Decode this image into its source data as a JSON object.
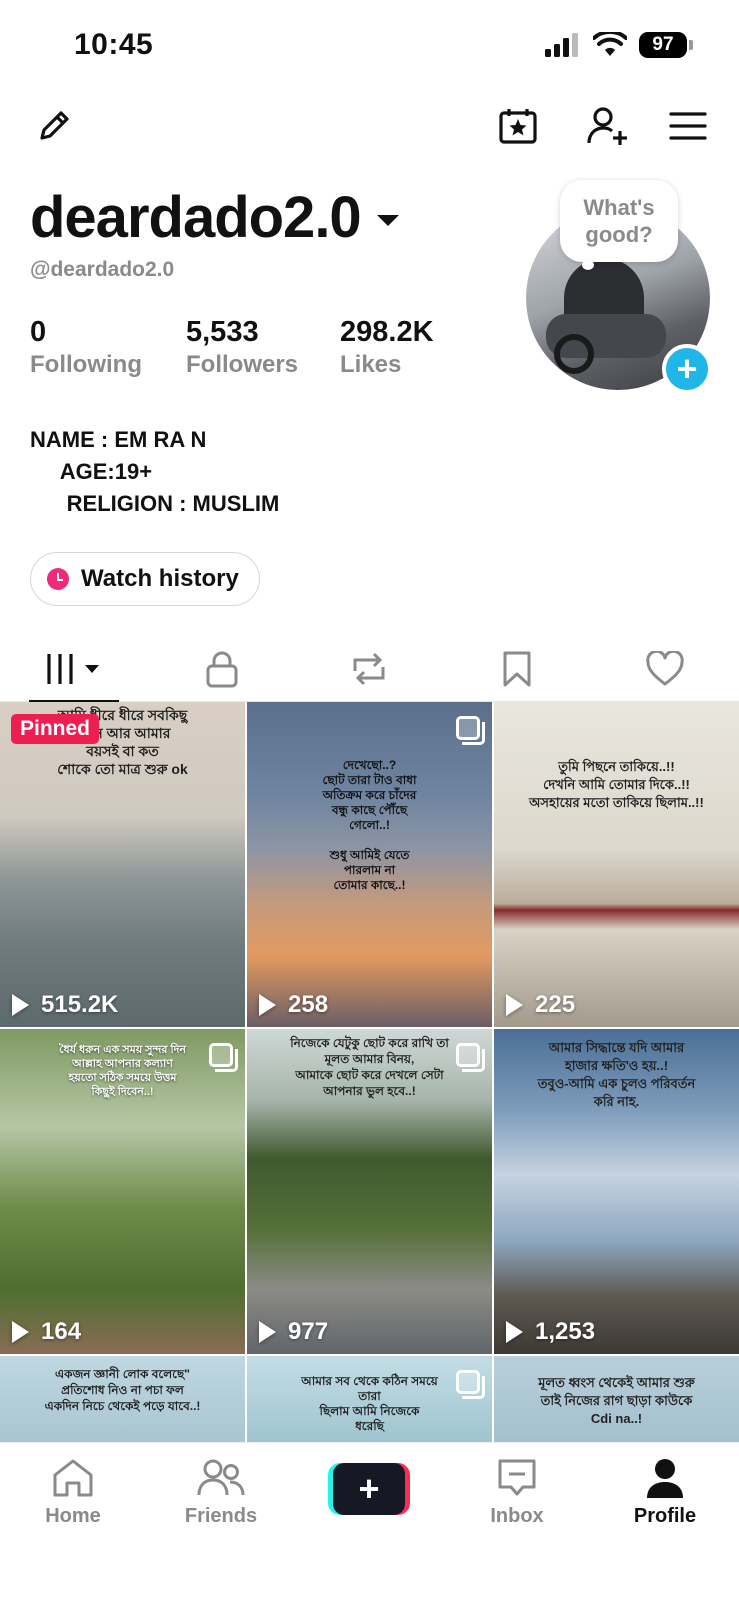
{
  "status": {
    "time": "10:45",
    "battery": "97"
  },
  "profile": {
    "display_name": "deardado2.0",
    "handle": "@deardado2.0",
    "stats": [
      {
        "value": "0",
        "label": "Following"
      },
      {
        "value": "5,533",
        "label": "Followers"
      },
      {
        "value": "298.2K",
        "label": "Likes"
      }
    ],
    "bubble": "What's good?",
    "bio": "NAME : EM RA N\n     AGE:19+\n      RELIGION : MUSLIM",
    "watch_history": "Watch history"
  },
  "icons": {
    "edit": "pencil-icon",
    "calendar": "calendar-star-icon",
    "add_friend": "add-user-icon",
    "menu": "menu-icon"
  },
  "tabs": [
    {
      "name": "videos",
      "icon": "grid-icon",
      "active": true
    },
    {
      "name": "private",
      "icon": "lock-icon"
    },
    {
      "name": "reposts",
      "icon": "repost-icon"
    },
    {
      "name": "favorites",
      "icon": "bookmark-icon"
    },
    {
      "name": "liked",
      "icon": "heart-icon"
    }
  ],
  "grid": {
    "pinned_label": "Pinned",
    "items": [
      {
        "views": "515.2K",
        "text": "আমি ধীরে ধীরে সবকিছু\nএখন আর আমার\nবয়সই বা কত\nশোকে তো মাত্র শুরু ok"
      },
      {
        "views": "258",
        "text": "দেখেছো..?\nছোট তারা টাও বাধা\nঅতিক্রম করে চাঁদের\nবন্ধু কাছে পৌঁছে\nগেলো..!\n\nশুধু আমিই যেতে\nপারলাম না\nতোমার কাছে..!"
      },
      {
        "views": "225",
        "text": "তুমি পিছনে তাকিয়ে..!!\nদেখনি আমি তোমার দিকে..!!\nঅসহায়ের মতো তাকিয়ে ছিলাম..!!"
      },
      {
        "views": "164",
        "text": "ধৈর্য ধরুন এক সময় সুন্দর দিন\nআল্লাহ আপনার কল্যাণ\nহয়তো সঠিক সময়ে উত্তম\nকিছুই দিবেন..!"
      },
      {
        "views": "977",
        "text": "নিজেকে যেটুকু ছোট করে রাখি তা\nমূলত আমার বিনয়,\nআমাকে ছোট করে দেখলে সেটা\nআপনার ভুল হবে..!"
      },
      {
        "views": "1,253",
        "text": "আমার সিদ্ধান্তে যদি আমার\nহাজার ক্ষতি'ও হয়..!\nতবুও-আমি এক চুলও পরিবর্তন\nকরি নাহ."
      },
      {
        "views": "",
        "text": "একজন জ্ঞানী লোক বলেছে\"\nপ্রতিশোধ নিও না পচা ফল\nএকদিন নিচে থেকেই পড়ে যাবে..!"
      },
      {
        "views": "",
        "text": "আমার সব থেকে কঠিন সময়ে\nতারা\nছিলাম আমি নিজেকে\nধরেছি"
      },
      {
        "views": "",
        "text": "মূলত ধ্বংস থেকেই আমার শুরু\nতাই নিজের রাগ ছাড়া কাউকে\nCdi na..!"
      }
    ]
  },
  "nav": [
    {
      "label": "Home",
      "icon": "home-icon"
    },
    {
      "label": "Friends",
      "icon": "friends-icon"
    },
    {
      "label": "",
      "icon": "create-plus-icon"
    },
    {
      "label": "Inbox",
      "icon": "inbox-icon"
    },
    {
      "label": "Profile",
      "icon": "profile-icon",
      "active": true
    }
  ],
  "colors": {
    "accent_blue": "#20b6e8",
    "pinned_red": "#ee1d52",
    "muted_text": "#8a8a8a"
  }
}
